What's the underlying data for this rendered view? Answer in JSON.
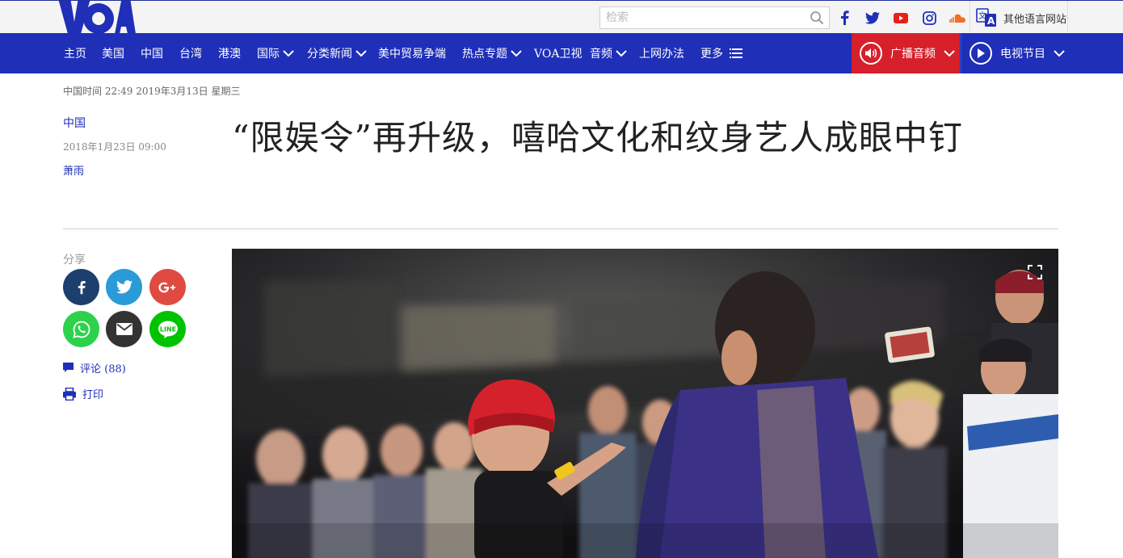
{
  "colors": {
    "brand_blue": "#1f2fb8",
    "radio_red": "#d6202b",
    "text": "#222222",
    "muted": "#888888"
  },
  "header": {
    "logo_text": "VOA",
    "search": {
      "placeholder": "检索",
      "value": ""
    },
    "social_icons": [
      "facebook-icon",
      "twitter-icon",
      "youtube-icon",
      "instagram-icon",
      "soundcloud-icon"
    ],
    "other_languages": "其他语言网站"
  },
  "nav": {
    "items": [
      {
        "label": "主页",
        "dropdown": false
      },
      {
        "label": "美国",
        "dropdown": false
      },
      {
        "label": "中国",
        "dropdown": false
      },
      {
        "label": "台湾",
        "dropdown": false
      },
      {
        "label": "港澳",
        "dropdown": false
      },
      {
        "label": "国际",
        "dropdown": true
      },
      {
        "label": "分类新闻",
        "dropdown": true
      },
      {
        "label": "美中贸易争端",
        "dropdown": false
      },
      {
        "label": "热点专题",
        "dropdown": true
      },
      {
        "label": "VOA卫视",
        "dropdown": false
      },
      {
        "label": "音频",
        "dropdown": true
      },
      {
        "label": "上网办法",
        "dropdown": false
      },
      {
        "label": "更多",
        "dropdown": false,
        "icon": "menu-icon"
      }
    ],
    "radio": "广播音频",
    "tv": "电视节目"
  },
  "page": {
    "datetime": "中国时间 22:49 2019年3月13日 星期三"
  },
  "article": {
    "category": "中国",
    "published": "2018年1月23日 09:00",
    "author": "萧雨",
    "headline": "“限娱令”再升级，嘻哈文化和纹身艺人成眼中钉"
  },
  "share": {
    "label": "分享",
    "buttons": [
      {
        "name": "facebook",
        "color": "#1c3f6e"
      },
      {
        "name": "twitter",
        "color": "#2a9bd6"
      },
      {
        "name": "google-plus",
        "color": "#e04b41"
      },
      {
        "name": "whatsapp",
        "color": "#2dd24c"
      },
      {
        "name": "email",
        "color": "#333333"
      },
      {
        "name": "line",
        "color": "#00c300"
      }
    ],
    "comments": "评论 (88)",
    "print": "打印"
  }
}
